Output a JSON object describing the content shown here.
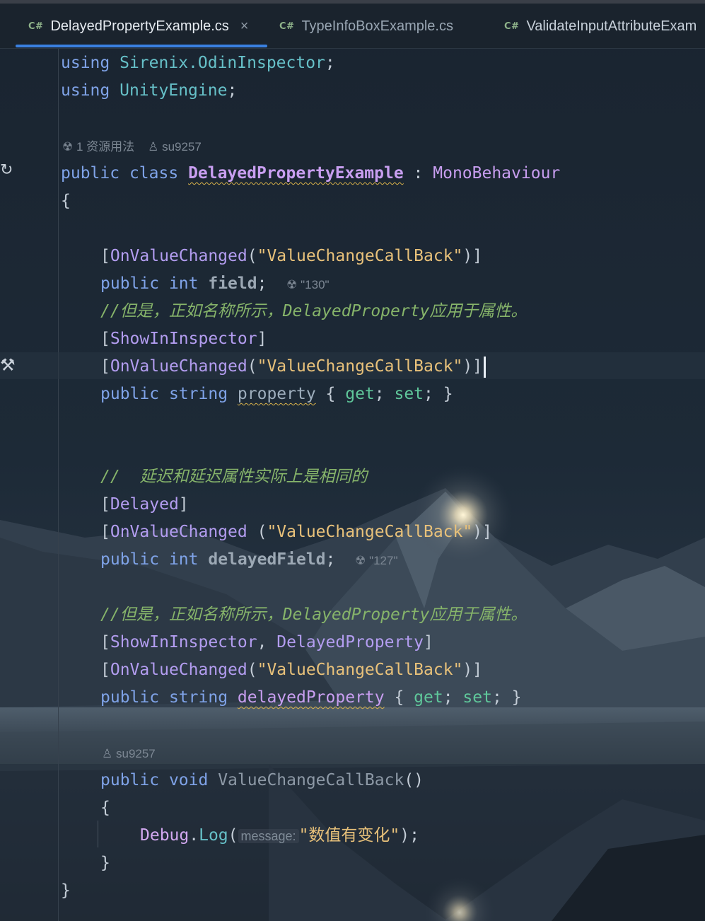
{
  "tabs": [
    {
      "lang": "C#",
      "label": "DelayedPropertyExample.cs",
      "close": "×",
      "active": true
    },
    {
      "lang": "C#",
      "label": "TypeInfoBoxExample.cs",
      "active": false
    },
    {
      "lang": "C#",
      "label": "ValidateInputAttributeExam",
      "active": false
    }
  ],
  "code": {
    "l1": {
      "kw": "using",
      "ns": "Sirenix.OdinInspector",
      "end": ";"
    },
    "l2": {
      "kw": "using",
      "ns": "UnityEngine",
      "end": ";"
    },
    "lens_class": {
      "usages": "1 资源用法",
      "author": "su9257"
    },
    "l3": {
      "kw1": "public",
      "kw2": "class",
      "name": "DelayedPropertyExample",
      "colon": " : ",
      "base": "MonoBehaviour"
    },
    "brace_open": "{",
    "l5": {
      "open": "[",
      "attr": "OnValueChanged",
      "paren": "(",
      "str": "\"ValueChangeCallBack\"",
      "close": ")]"
    },
    "l6": {
      "kw1": "public",
      "kw2": "int",
      "field": "field",
      "end": ";",
      "inlay": "\"130\""
    },
    "l7": {
      "comment": "//但是，正如名称所示，DelayedProperty应用于属性。"
    },
    "l8": {
      "open": "[",
      "attr": "ShowInInspector",
      "close": "]"
    },
    "l9": {
      "open": "[",
      "attr": "OnValueChanged",
      "paren": "(",
      "str": "\"ValueChangeCallBack\"",
      "close": ")]"
    },
    "l10": {
      "kw1": "public",
      "kw2": "string",
      "prop": "property",
      "b1": " { ",
      "get": "get",
      "semi1": "; ",
      "set": "set",
      "b2": "; }"
    },
    "l11": {
      "comment": "//  延迟和延迟属性实际上是相同的"
    },
    "l12": {
      "open": "[",
      "attr": "Delayed",
      "close": "]"
    },
    "l13": {
      "open": "[",
      "attr": "OnValueChanged",
      "paren": " (",
      "str": "\"ValueChangeCallBack\"",
      "close": ")]"
    },
    "l14": {
      "kw1": "public",
      "kw2": "int",
      "field": "delayedField",
      "end": ";",
      "inlay": "\"127\""
    },
    "l15": {
      "comment": "//但是，正如名称所示，DelayedProperty应用于属性。"
    },
    "l16": {
      "open": "[",
      "attr1": "ShowInInspector",
      "comma": ", ",
      "attr2": "DelayedProperty",
      "close": "]"
    },
    "l17": {
      "open": "[",
      "attr": "OnValueChanged",
      "paren": "(",
      "str": "\"ValueChangeCallBack\"",
      "close": ")]"
    },
    "l18": {
      "kw1": "public",
      "kw2": "string",
      "prop": "delayedProperty",
      "b1": " { ",
      "get": "get",
      "semi1": "; ",
      "set": "set",
      "b2": "; }"
    },
    "lens_method": {
      "author": "su9257"
    },
    "l19": {
      "kw1": "public",
      "kw2": "void",
      "name": "ValueChangeCallBack",
      "parens": "()"
    },
    "brace_open2": "{",
    "l21": {
      "cls": "Debug",
      "dot": ".",
      "mth": "Log",
      "open": "(",
      "hint": "message:",
      "str": "\"数值有变化\"",
      "close": ");"
    },
    "brace_close2": "}",
    "brace_close": "}"
  }
}
